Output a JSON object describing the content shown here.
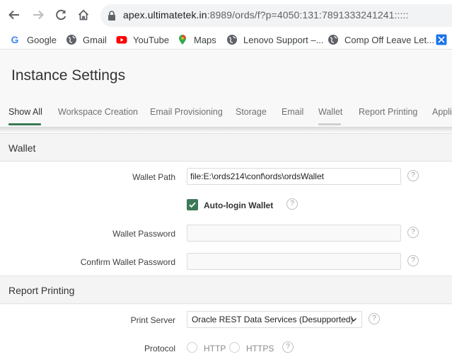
{
  "browser": {
    "url_host": "apex.ultimatetek.in",
    "url_rest": ":8989/ords/f?p=4050:131:7891333241241:::::",
    "bookmarks": [
      "Google",
      "Gmail",
      "YouTube",
      "Maps",
      "Lenovo Support –...",
      "Comp Off Leave Let..."
    ]
  },
  "page": {
    "title": "Instance Settings",
    "tabs": [
      "Show All",
      "Workspace Creation",
      "Email Provisioning",
      "Storage",
      "Email",
      "Wallet",
      "Report Printing",
      "Appli"
    ],
    "active_tab": "Show All",
    "active_tab_color": "#3b7a57"
  },
  "wallet": {
    "region_title": "Wallet",
    "wallet_path_label": "Wallet Path",
    "wallet_path_value": "file:E:\\ords214\\conf\\ords\\ordsWallet",
    "auto_login_label": "Auto-login Wallet",
    "auto_login_checked": true,
    "wallet_password_label": "Wallet Password",
    "confirm_password_label": "Confirm Wallet Password"
  },
  "report_printing": {
    "region_title": "Report Printing",
    "print_server_label": "Print Server",
    "print_server_value": "Oracle REST Data Services (Desupported)",
    "protocol_label": "Protocol",
    "protocol_options": [
      "HTTP",
      "HTTPS"
    ]
  },
  "help_glyph": "?"
}
